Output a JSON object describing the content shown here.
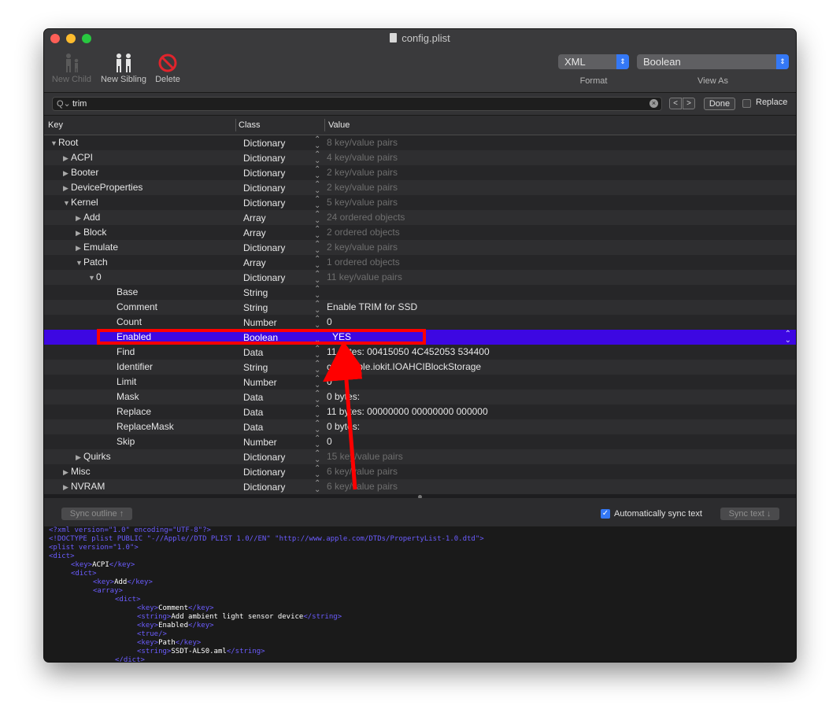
{
  "window": {
    "title": "config.plist"
  },
  "toolbar": {
    "new_child": "New Child",
    "new_sibling": "New Sibling",
    "delete": "Delete",
    "format_value": "XML",
    "format_label": "Format",
    "view_as_value": "Boolean",
    "view_as_label": "View As"
  },
  "search": {
    "query": "trim",
    "done": "Done",
    "replace_label": "Replace",
    "replace_checked": false
  },
  "columns": {
    "key": "Key",
    "class": "Class",
    "value": "Value"
  },
  "rows": [
    {
      "key": "Root",
      "indent": 0,
      "disclosure": "open",
      "class": "Dictionary",
      "value": "8 key/value pairs",
      "dim": true
    },
    {
      "key": "ACPI",
      "indent": 1,
      "disclosure": "closed",
      "class": "Dictionary",
      "value": "4 key/value pairs",
      "dim": true
    },
    {
      "key": "Booter",
      "indent": 1,
      "disclosure": "closed",
      "class": "Dictionary",
      "value": "2 key/value pairs",
      "dim": true
    },
    {
      "key": "DeviceProperties",
      "indent": 1,
      "disclosure": "closed",
      "class": "Dictionary",
      "value": "2 key/value pairs",
      "dim": true
    },
    {
      "key": "Kernel",
      "indent": 1,
      "disclosure": "open",
      "class": "Dictionary",
      "value": "5 key/value pairs",
      "dim": true
    },
    {
      "key": "Add",
      "indent": 2,
      "disclosure": "closed",
      "class": "Array",
      "value": "24 ordered objects",
      "dim": true
    },
    {
      "key": "Block",
      "indent": 2,
      "disclosure": "closed",
      "class": "Array",
      "value": "2 ordered objects",
      "dim": true
    },
    {
      "key": "Emulate",
      "indent": 2,
      "disclosure": "closed",
      "class": "Dictionary",
      "value": "2 key/value pairs",
      "dim": true
    },
    {
      "key": "Patch",
      "indent": 2,
      "disclosure": "open",
      "class": "Array",
      "value": "1 ordered objects",
      "dim": true
    },
    {
      "key": "0",
      "indent": 3,
      "disclosure": "open",
      "class": "Dictionary",
      "value": "11 key/value pairs",
      "dim": true
    },
    {
      "key": "Base",
      "indent": 4,
      "disclosure": "none",
      "class": "String",
      "value": "",
      "dim": false
    },
    {
      "key": "Comment",
      "indent": 4,
      "disclosure": "none",
      "class": "String",
      "value": "Enable TRIM for SSD",
      "dim": false
    },
    {
      "key": "Count",
      "indent": 4,
      "disclosure": "none",
      "class": "Number",
      "value": "0",
      "dim": false
    },
    {
      "key": "Enabled",
      "indent": 4,
      "disclosure": "none",
      "class": "Boolean",
      "value": "YES",
      "dim": false,
      "selected": true
    },
    {
      "key": "Find",
      "indent": 4,
      "disclosure": "none",
      "class": "Data",
      "value": "11 bytes: 00415050 4C452053 534400",
      "dim": false
    },
    {
      "key": "Identifier",
      "indent": 4,
      "disclosure": "none",
      "class": "String",
      "value": "com.apple.iokit.IOAHCIBlockStorage",
      "dim": false
    },
    {
      "key": "Limit",
      "indent": 4,
      "disclosure": "none",
      "class": "Number",
      "value": "0",
      "dim": false
    },
    {
      "key": "Mask",
      "indent": 4,
      "disclosure": "none",
      "class": "Data",
      "value": "0 bytes:",
      "dim": false
    },
    {
      "key": "Replace",
      "indent": 4,
      "disclosure": "none",
      "class": "Data",
      "value": "11 bytes: 00000000 00000000 000000",
      "dim": false
    },
    {
      "key": "ReplaceMask",
      "indent": 4,
      "disclosure": "none",
      "class": "Data",
      "value": "0 bytes:",
      "dim": false
    },
    {
      "key": "Skip",
      "indent": 4,
      "disclosure": "none",
      "class": "Number",
      "value": "0",
      "dim": false
    },
    {
      "key": "Quirks",
      "indent": 2,
      "disclosure": "closed",
      "class": "Dictionary",
      "value": "15 key/value pairs",
      "dim": true
    },
    {
      "key": "Misc",
      "indent": 1,
      "disclosure": "closed",
      "class": "Dictionary",
      "value": "6 key/value pairs",
      "dim": true
    },
    {
      "key": "NVRAM",
      "indent": 1,
      "disclosure": "closed",
      "class": "Dictionary",
      "value": "6 key/value pairs",
      "dim": true
    }
  ],
  "sync": {
    "sync_outline": "Sync outline ↑",
    "auto_sync": "Automatically sync text",
    "auto_sync_checked": true,
    "sync_text": "Sync text ↓"
  },
  "xml_lines": [
    {
      "indent": 0,
      "parts": [
        [
          "tag",
          "<?xml version=\"1.0\" encoding=\"UTF-8\"?>"
        ]
      ]
    },
    {
      "indent": 0,
      "parts": [
        [
          "tag",
          "<!DOCTYPE plist PUBLIC \"-//Apple//DTD PLIST 1.0//EN\" \"http://www.apple.com/DTDs/PropertyList-1.0.dtd\">"
        ]
      ]
    },
    {
      "indent": 0,
      "parts": [
        [
          "tag",
          "<plist version=\"1.0\">"
        ]
      ]
    },
    {
      "indent": 0,
      "parts": [
        [
          "tag",
          "<dict>"
        ]
      ]
    },
    {
      "indent": 1,
      "parts": [
        [
          "tag",
          "<key>"
        ],
        [
          "txt",
          "ACPI"
        ],
        [
          "tag",
          "</key>"
        ]
      ]
    },
    {
      "indent": 1,
      "parts": [
        [
          "tag",
          "<dict>"
        ]
      ]
    },
    {
      "indent": 2,
      "parts": [
        [
          "tag",
          "<key>"
        ],
        [
          "txt",
          "Add"
        ],
        [
          "tag",
          "</key>"
        ]
      ]
    },
    {
      "indent": 2,
      "parts": [
        [
          "tag",
          "<array>"
        ]
      ]
    },
    {
      "indent": 3,
      "parts": [
        [
          "tag",
          "<dict>"
        ]
      ]
    },
    {
      "indent": 4,
      "parts": [
        [
          "tag",
          "<key>"
        ],
        [
          "txt",
          "Comment"
        ],
        [
          "tag",
          "</key>"
        ]
      ]
    },
    {
      "indent": 4,
      "parts": [
        [
          "tag",
          "<string>"
        ],
        [
          "txt",
          "Add ambient light sensor device"
        ],
        [
          "tag",
          "</string>"
        ]
      ]
    },
    {
      "indent": 4,
      "parts": [
        [
          "tag",
          "<key>"
        ],
        [
          "txt",
          "Enabled"
        ],
        [
          "tag",
          "</key>"
        ]
      ]
    },
    {
      "indent": 4,
      "parts": [
        [
          "tag",
          "<true/>"
        ]
      ]
    },
    {
      "indent": 4,
      "parts": [
        [
          "tag",
          "<key>"
        ],
        [
          "txt",
          "Path"
        ],
        [
          "tag",
          "</key>"
        ]
      ]
    },
    {
      "indent": 4,
      "parts": [
        [
          "tag",
          "<string>"
        ],
        [
          "txt",
          "SSDT-ALS0.aml"
        ],
        [
          "tag",
          "</string>"
        ]
      ]
    },
    {
      "indent": 3,
      "parts": [
        [
          "tag",
          "</dict>"
        ]
      ]
    }
  ],
  "colors": {
    "selection": "#3d07e2",
    "annotation": "#ff0000",
    "accent": "#3478f6",
    "xml_tag": "#6b5cff"
  }
}
